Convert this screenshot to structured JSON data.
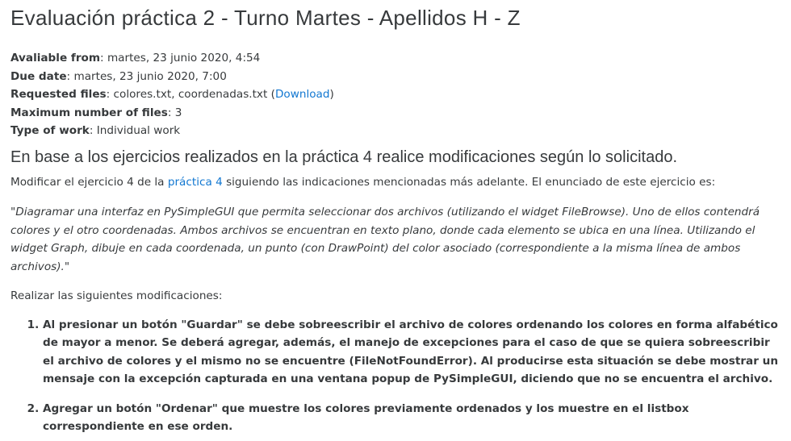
{
  "title": "Evaluación práctica 2 - Turno Martes - Apellidos H - Z",
  "meta": {
    "available_label": "Avaliable from",
    "available_value": "martes, 23 junio 2020, 4:54",
    "due_label": "Due date",
    "due_value": "martes, 23 junio 2020, 7:00",
    "files_label": "Requested files",
    "files_value": "colores.txt, coordenadas.txt",
    "download_label": "Download",
    "maxfiles_label": "Maximum number of files",
    "maxfiles_value": "3",
    "work_label": "Type of work",
    "work_value": "Individual work"
  },
  "subtitle": "En base a los ejercicios realizados en la práctica 4 realice modificaciones según lo solicitado.",
  "intro": {
    "before": "Modificar el ejercicio 4 de la ",
    "link": "práctica 4",
    "after": " siguiendo las indicaciones mencionadas más adelante. El enunciado de este ejercicio es:"
  },
  "quote": "\"Diagramar una interfaz en PySimpleGUI que permita seleccionar dos archivos (utilizando el widget FileBrowse). Uno de ellos contendrá colores y el otro coordenadas. Ambos archivos se encuentran en texto plano, donde cada elemento se ubica en una línea. Utilizando el widget Graph, dibuje en cada coordenada, un punto (con DrawPoint) del color asociado (correspondiente a la misma línea de ambos archivos).\"",
  "lead": "Realizar las siguientes modificaciones:",
  "items": [
    "Al presionar un botón \"Guardar\" se debe sobreescribir el archivo de colores ordenando los colores en forma alfabético de mayor a menor. Se deberá agregar, además, el manejo de excepciones para el caso de que se quiera sobreescribir el archivo de colores y el mismo no se encuentre (FileNotFoundError). Al producirse esta situación se debe mostrar un mensaje con la excepción capturada en una ventana popup de PySimpleGUI, diciendo que no se encuentra el archivo.",
    "Agregar un botón \"Ordenar\" que muestre los colores previamente ordenados y los muestre en el listbox correspondiente en ese orden."
  ]
}
